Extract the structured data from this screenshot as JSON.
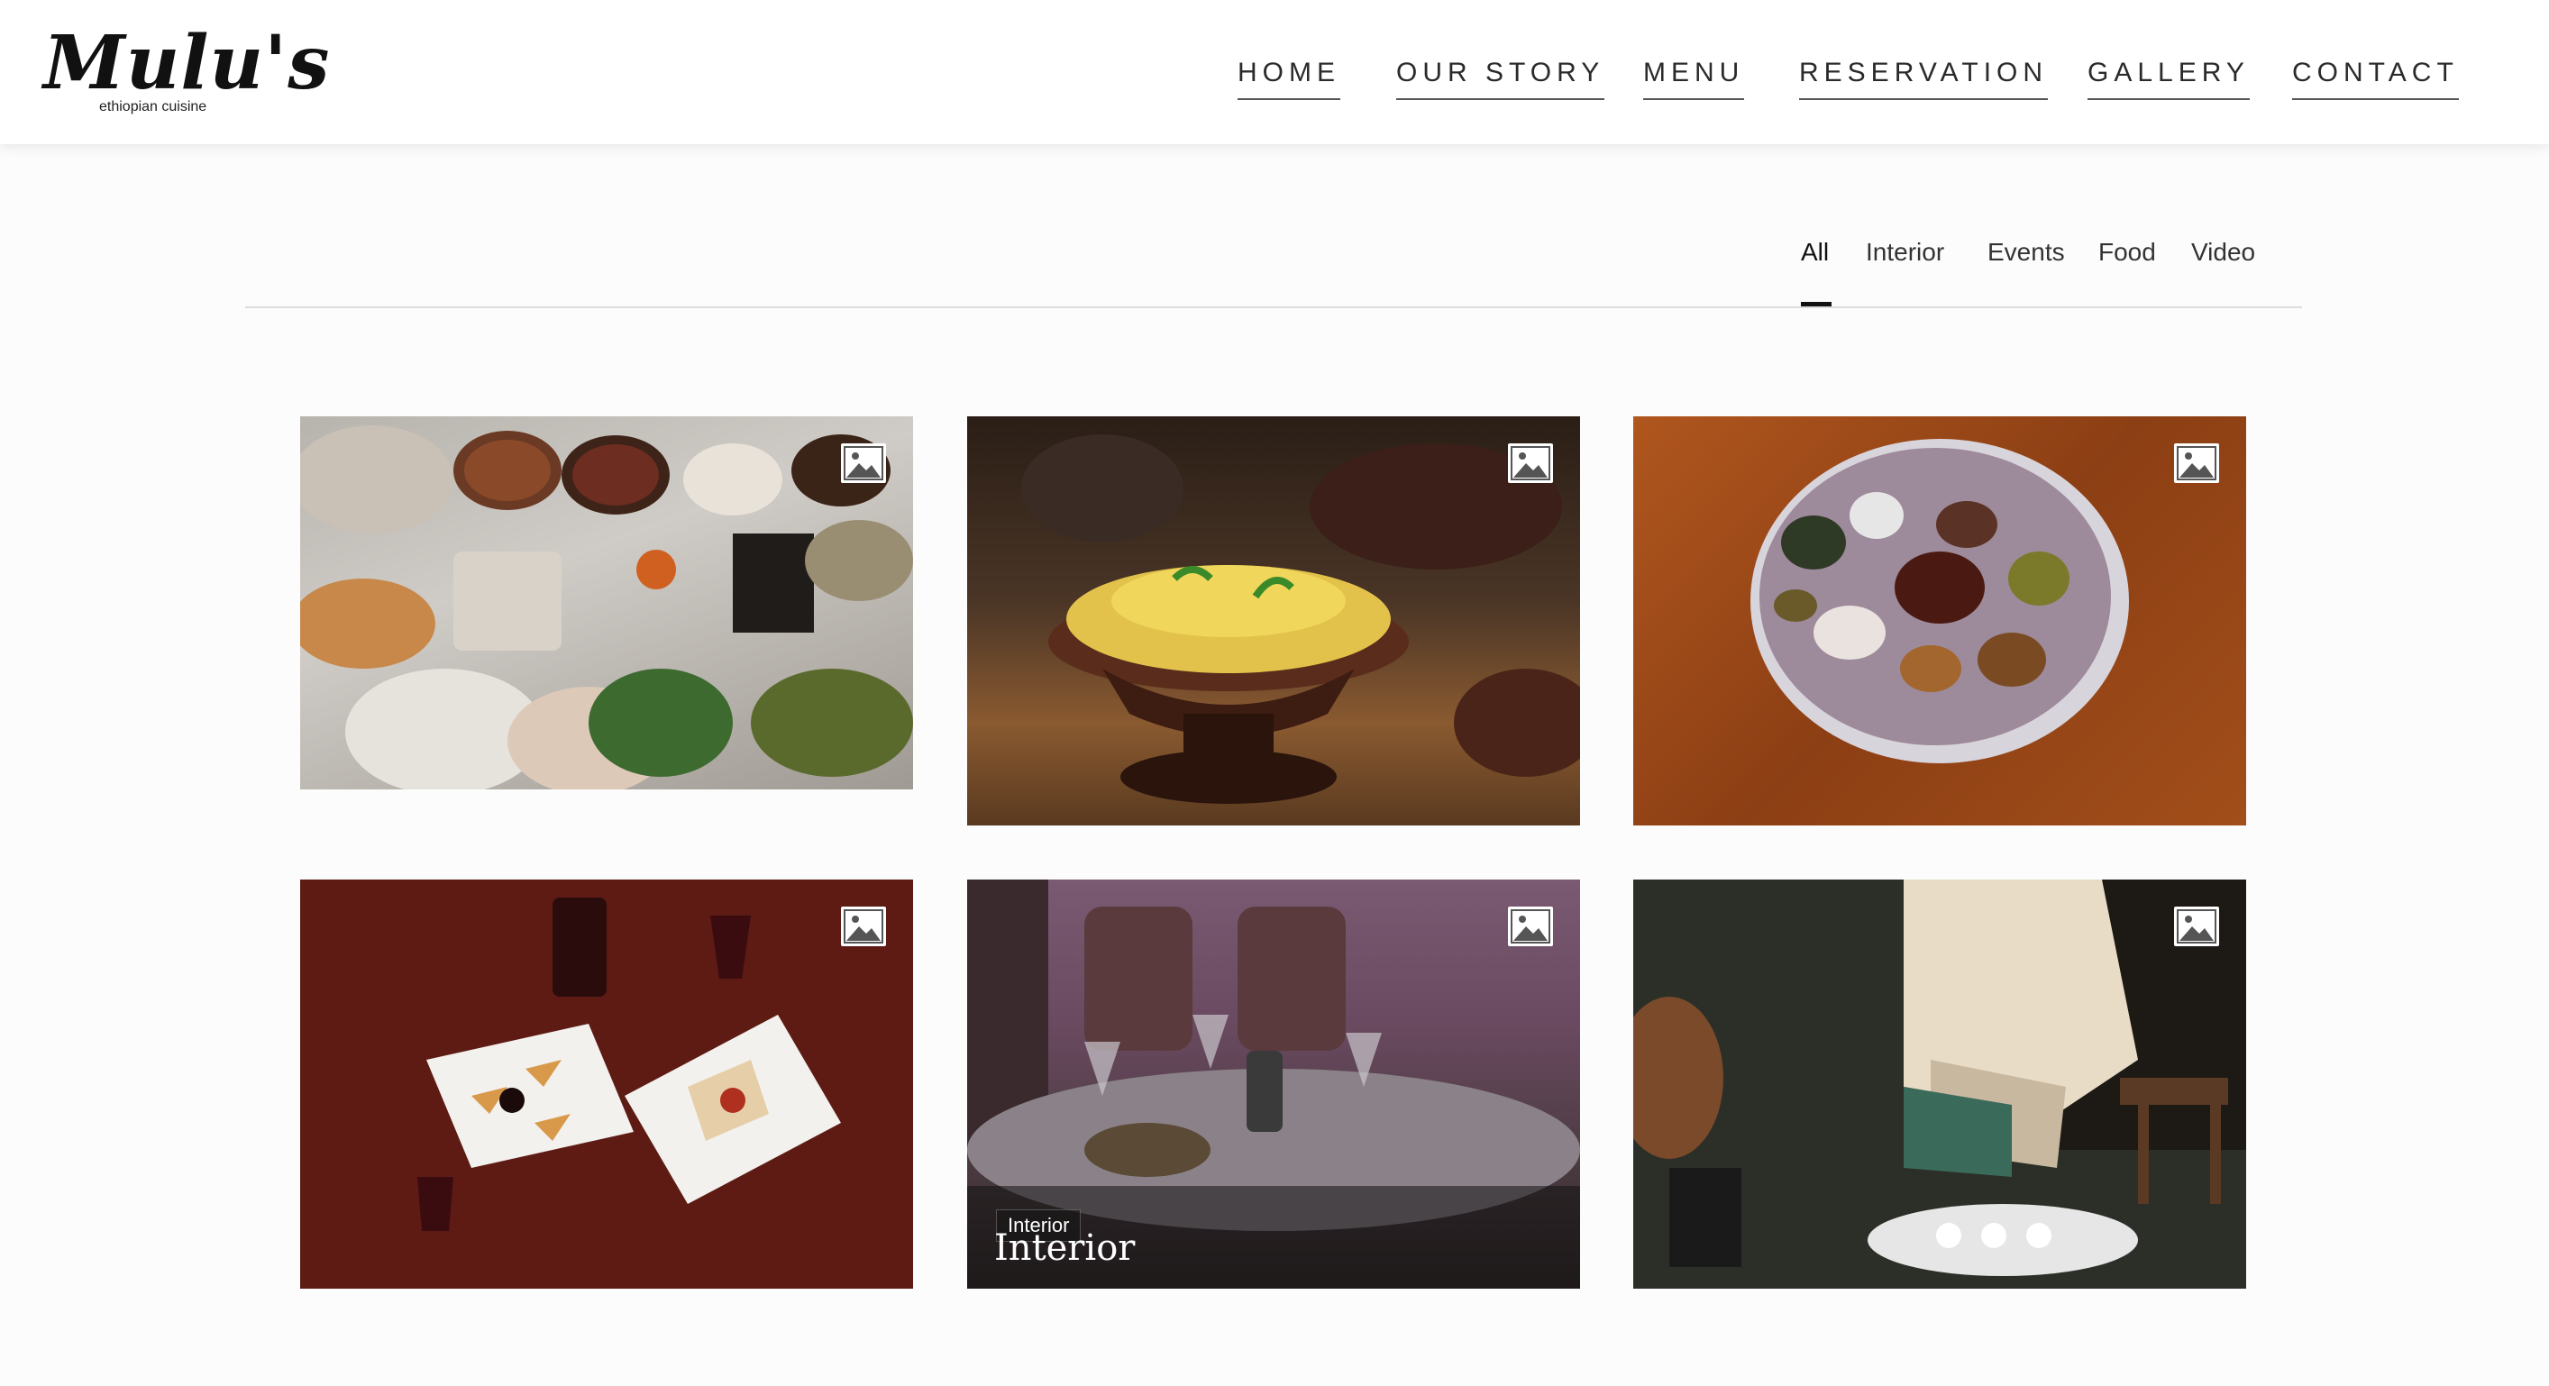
{
  "brand": {
    "name": "Mulu's",
    "tagline": "ethiopian cuisine"
  },
  "nav": {
    "items": [
      "HOME",
      "OUR STORY",
      "MENU",
      "RESERVATION",
      "GALLERY",
      "CONTACT"
    ]
  },
  "filters": {
    "items": [
      "All",
      "Interior",
      "Events",
      "Food",
      "Video"
    ],
    "active": "All"
  },
  "gallery": {
    "tiles": [
      {
        "icon": "image-icon"
      },
      {
        "icon": "image-icon"
      },
      {
        "icon": "image-icon"
      },
      {
        "icon": "image-icon"
      },
      {
        "icon": "image-icon",
        "tag": "Interior",
        "title": "Interior"
      },
      {
        "icon": "image-icon"
      }
    ]
  }
}
